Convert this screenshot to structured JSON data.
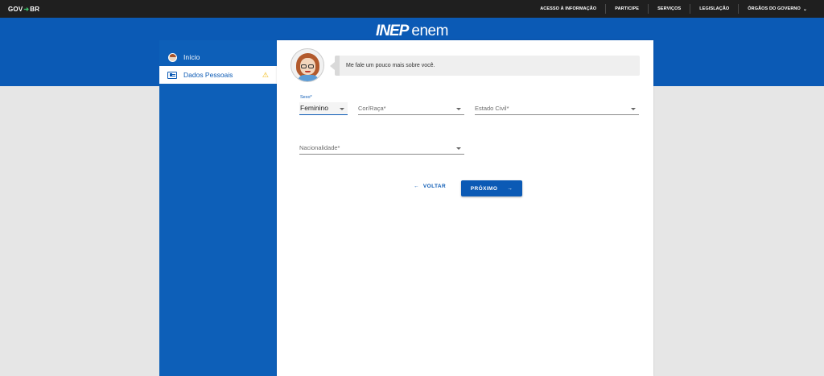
{
  "govbar": {
    "brand_left": "GOV",
    "brand_right": "BR",
    "nav": [
      "ACESSO À INFORMAÇÃO",
      "PARTICIPE",
      "SERVIÇOS",
      "LEGISLAÇÃO",
      "ÓRGÃOS DO GOVERNO"
    ]
  },
  "logo": {
    "inep": "INEP",
    "enem": "enem"
  },
  "sidebar": {
    "items": [
      {
        "label": "Início"
      },
      {
        "label": "Dados Pessoais",
        "warning": "⚠"
      }
    ]
  },
  "chat": {
    "message": "Me fale um pouco mais sobre você."
  },
  "form": {
    "sexo": {
      "label": "Sexo*",
      "value": "Feminino"
    },
    "cor_raca": {
      "label": "Cor/Raça*"
    },
    "estado_civil": {
      "label": "Estado Civil*"
    },
    "nacionalidade": {
      "label": "Nacionalidade*"
    }
  },
  "actions": {
    "back_label": "VOLTAR",
    "next_label": "PRÓXIMO"
  },
  "colors": {
    "primary": "#0b5ab5",
    "govbar": "#1f1f1f",
    "warning": "#f0b400"
  }
}
